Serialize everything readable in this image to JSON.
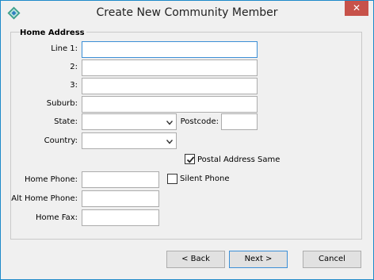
{
  "window": {
    "title": "Create New Community Member",
    "close_label": "✕",
    "app_icon": "app-diamond-icon"
  },
  "section": {
    "title": "Home Address"
  },
  "fields": {
    "line1_label": "Line 1:",
    "line2_label": "2:",
    "line3_label": "3:",
    "suburb_label": "Suburb:",
    "state_label": "State:",
    "postcode_label": "Postcode:",
    "country_label": "Country:",
    "home_phone_label": "Home Phone:",
    "alt_home_phone_label": "Alt Home Phone:",
    "home_fax_label": "Home Fax:"
  },
  "checkboxes": {
    "postal_same_label": "Postal Address Same",
    "postal_same_checked": true,
    "silent_phone_label": "Silent Phone",
    "silent_phone_checked": false
  },
  "buttons": {
    "back": "< Back",
    "next": "Next >",
    "cancel": "Cancel"
  },
  "colors": {
    "accent": "#3c8fd6",
    "close": "#c7524a",
    "window_border": "#1e8ac9"
  }
}
